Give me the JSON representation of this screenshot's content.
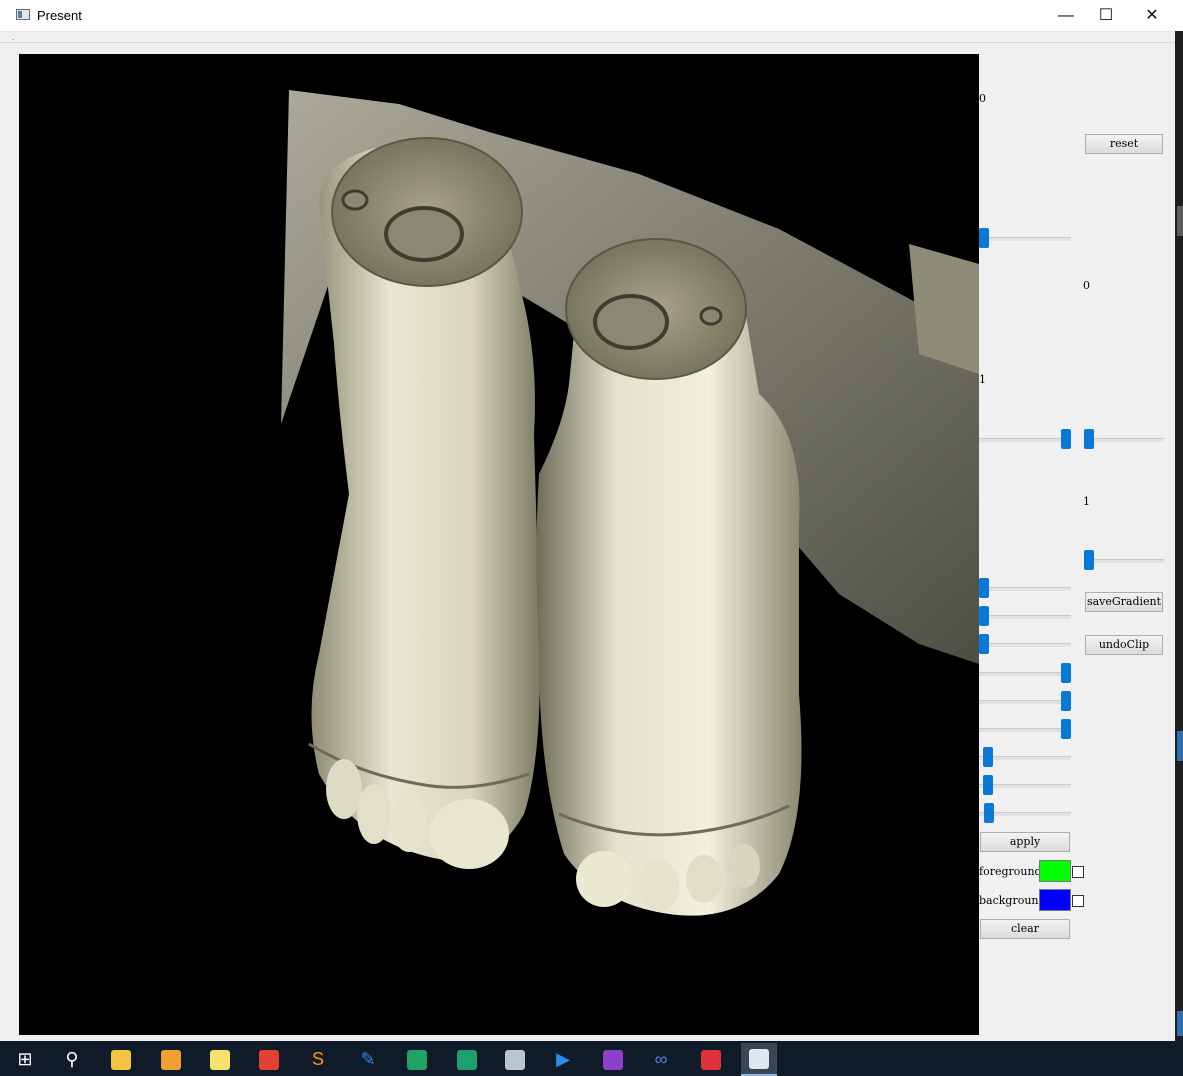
{
  "window": {
    "title": "Present",
    "minimize_glyph": "—",
    "maximize_glyph": "☐",
    "close_glyph": "✕"
  },
  "menu": {
    "grip": "."
  },
  "viewport": {
    "image": "3d volume rendering of two feet",
    "background": "#000000"
  },
  "controls": {
    "num_0a": "0",
    "num_0b": "0",
    "num_1a": "1",
    "num_1b": "1",
    "reset_label": "reset",
    "save_gradient_label": "saveGradient",
    "undo_clip_label": "undoClip",
    "apply_label": "apply",
    "clear_label": "clear",
    "foreground_label": "foreground",
    "background_label": "background",
    "foreground_color": "#00ff00",
    "background_color": "#0000ff",
    "slider_levels": {
      "top_single": 0.0,
      "pair_left": 1.0,
      "pair_right": 0.0,
      "right_single": 0.0,
      "low_group_1": 0.0,
      "low_group_2": 0.0,
      "low_group_3": 0.0,
      "high_group_1": 1.0,
      "high_group_2": 1.0,
      "high_group_3": 1.0,
      "mid_group_1": 0.05,
      "mid_group_2": 0.05,
      "mid_group_3": 0.06
    }
  },
  "taskbar": {
    "items": [
      {
        "name": "start-icon",
        "glyph": "⊞",
        "color": "#ffffff"
      },
      {
        "name": "search-icon",
        "glyph": "⚲",
        "color": "#ffffff"
      },
      {
        "name": "file-explorer-icon",
        "glyph": "",
        "color": "#f5c342"
      },
      {
        "name": "image-viewer-icon",
        "glyph": "",
        "color": "#f0a030"
      },
      {
        "name": "sticky-notes-icon",
        "glyph": "",
        "color": "#f7e36b"
      },
      {
        "name": "chrome-icon",
        "glyph": "",
        "color": "#e34133"
      },
      {
        "name": "sublime-text-icon",
        "glyph": "S",
        "color": "#ff9800"
      },
      {
        "name": "editor-icon",
        "glyph": "✎",
        "color": "#2f87e8"
      },
      {
        "name": "app-green-icon",
        "glyph": "",
        "color": "#21a366"
      },
      {
        "name": "app-green-2-icon",
        "glyph": "",
        "color": "#1f9e6e"
      },
      {
        "name": "paint-icon",
        "glyph": "",
        "color": "#b8c4d0"
      },
      {
        "name": "media-player-icon",
        "glyph": "▶",
        "color": "#2a8cf0"
      },
      {
        "name": "visual-studio-icon",
        "glyph": "",
        "color": "#8a3fc7"
      },
      {
        "name": "infinity-icon",
        "glyph": "∞",
        "color": "#5b7fd6"
      },
      {
        "name": "app-red-icon",
        "glyph": "",
        "color": "#e0303a"
      },
      {
        "name": "present-window-icon",
        "glyph": "",
        "color": "#dfe6ee"
      }
    ]
  }
}
